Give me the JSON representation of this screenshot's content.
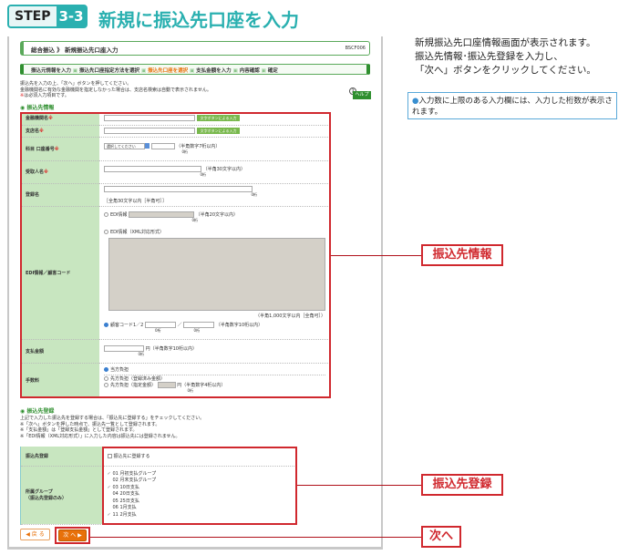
{
  "header": {
    "step_label": "STEP",
    "step_number": "3-3",
    "title": "新規に振込先口座を入力"
  },
  "screen": {
    "breadcrumb": "総合振込 》 新規振込先口座入力",
    "screen_id": "BSCF006",
    "steps": [
      "振込元情報を入力",
      "振込先口座指定方法を選択",
      "振込先口座を選択",
      "支払金額を入力",
      "内容確認",
      "確定"
    ],
    "current_step": 2,
    "instructions": [
      "振込先を入力の上、「次へ」ボタンを押してください。",
      "金融機関名に有効な金融機関を指定しなかった場合は、支店名検索は自動で表示されません。"
    ],
    "required_mark": "※",
    "required_note": "は必須入力項目です。",
    "help_label": "ヘルプ",
    "section1_title": "振込先情報",
    "fields": {
      "bank": {
        "label": "金融機関名",
        "button": "文字ボタンによる入力"
      },
      "branch": {
        "label": "支店名",
        "button": "文字ボタンによる入力"
      },
      "account": {
        "label": "科目 口座番号",
        "select": "選択してください",
        "hint": "（半角数字7桁以内）",
        "count": "0桁"
      },
      "payee": {
        "label": "受取人名",
        "hint": "（半角30文字以内）",
        "count": "0桁"
      },
      "reg_name": {
        "label": "登録名",
        "hint": "［全角30文字以内［半角可］］",
        "count": "0桁"
      },
      "edi": {
        "label": "EDI情報／顧客コード",
        "opt1": "EDI情報",
        "opt1_hint": "（半角20文字以内）",
        "opt1_count": "0桁",
        "opt2": "EDI情報（XML対応形式）",
        "opt2_hint": "（半角1,000文字以内［全角可］）",
        "opt3": "顧客コード1／2",
        "opt3_sep": "／",
        "opt3_hint": "（半角数字10桁以内）",
        "count": "0桁"
      },
      "amount": {
        "label": "支払金額",
        "unit": "円（半角数字10桁以内）",
        "count": "0桁"
      },
      "fee": {
        "label": "手数料",
        "opt1": "当方負担",
        "opt2": "先方負担（登録済み金額）",
        "opt3": "先方負担（指定金額）",
        "opt3_unit": "円（半角数字4桁以内）",
        "count": "0桁"
      }
    },
    "section2_title": "振込先登録",
    "section2_notes": [
      "上記で入力した振込先を登録する場合は、「振込先に登録する」をチェックしてください。",
      "※「次へ」ボタンを押した時点で、振込先一覧として登録されます。",
      "※「支払金額」は「登録支払金額」として登録されます。",
      "※「EDI情報（XML対応形式）」に入力した内容は振込先には登録されません。"
    ],
    "register": {
      "label": "振込先登録",
      "checkbox": "振込先に登録する",
      "checked": false
    },
    "group": {
      "label1": "所属グループ",
      "label2": "（振込先登録のみ）",
      "items": [
        {
          "text": "01 月初支払グループ",
          "checked": true
        },
        {
          "text": "02 月末支払グループ",
          "checked": false
        },
        {
          "text": "03 10日支払",
          "checked": true
        },
        {
          "text": "04 20日支払",
          "checked": false
        },
        {
          "text": "05 25日支払",
          "checked": false
        },
        {
          "text": "06 1月支払",
          "checked": false
        },
        {
          "text": "11 2月支払",
          "checked": true
        }
      ]
    },
    "back_button": "◀ 戻 る",
    "next_button": "次 へ ▶"
  },
  "side": {
    "lines": [
      "新規振込先口座情報画面が表示されます。",
      "振込先情報･振込先登録を入力し、",
      "「次へ」ボタンをクリックしてください。"
    ],
    "note": "入力数に上限のある入力欄には、入力した桁数が表示されます。"
  },
  "callouts": {
    "info": "振込先情報",
    "register": "振込先登録",
    "next": "次へ"
  },
  "colors": {
    "accent": "#2ab0b0",
    "highlight": "#d0282e",
    "label_bg": "#c8e6c0",
    "next_button": "#e8710a"
  }
}
